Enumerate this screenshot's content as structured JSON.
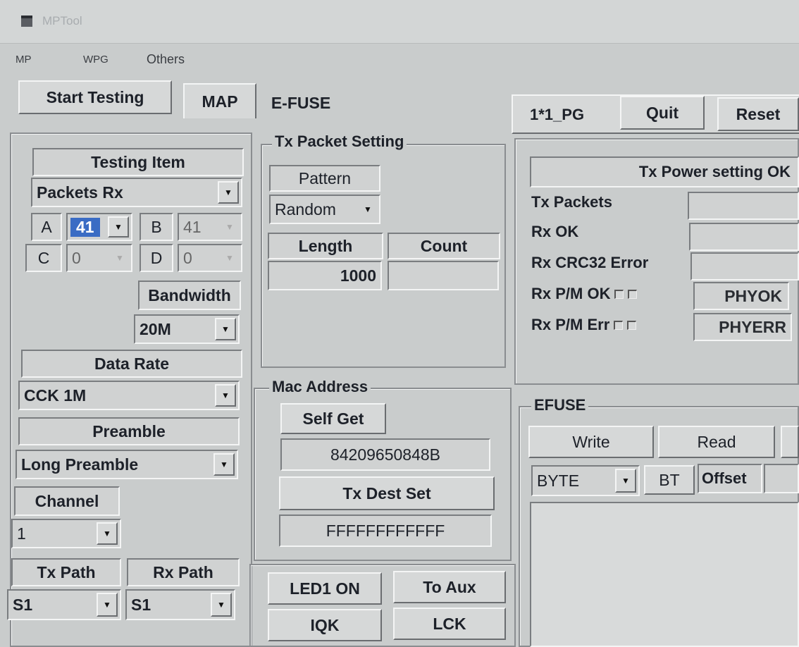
{
  "window": {
    "title": "MPTool"
  },
  "menu": {
    "items": [
      "MP",
      "WPG",
      "Others"
    ]
  },
  "toolbar": {
    "start_testing": "Start Testing",
    "tabs": [
      "MAP",
      "E-FUSE"
    ],
    "right_label": "1*1_PG",
    "quit": "Quit",
    "reset": "Reset"
  },
  "left": {
    "testing_item_label": "Testing Item",
    "testing_item_value": "Packets Rx",
    "antennas": [
      {
        "letter": "A",
        "value": "41"
      },
      {
        "letter": "B",
        "value": "41"
      },
      {
        "letter": "C",
        "value": "0"
      },
      {
        "letter": "D",
        "value": "0"
      }
    ],
    "bandwidth_label": "Bandwidth",
    "bandwidth_value": "20M",
    "data_rate_label": "Data Rate",
    "data_rate_value": "CCK 1M",
    "preamble_label": "Preamble",
    "preamble_value": "Long Preamble",
    "channel_label": "Channel",
    "channel_value": "1",
    "tx_path_label": "Tx Path",
    "tx_path_value": "S1",
    "rx_path_label": "Rx Path",
    "rx_path_value": "S1"
  },
  "tx_packet": {
    "title": "Tx Packet Setting",
    "pattern_label": "Pattern",
    "pattern_value": "Random",
    "length_label": "Length",
    "length_value": "1000",
    "count_label": "Count",
    "count_value": ""
  },
  "mac": {
    "title": "Mac Address",
    "self_get": "Self Get",
    "self_value": "84209650848B",
    "tx_dest_set": "Tx Dest Set",
    "dest_value": "FFFFFFFFFFFF"
  },
  "bottom_buttons": {
    "led": "LED1 ON",
    "to_aux": "To Aux",
    "iqk": "IQK",
    "lck": "LCK"
  },
  "status": {
    "message": "Tx Power setting OK",
    "tx_packets": "Tx Packets",
    "rx_ok": "Rx OK",
    "rx_crc": "Rx CRC32 Error",
    "rx_pm_ok": "Rx P/M OK",
    "rx_pm_err": "Rx P/M Err",
    "phyok": "PHYOK",
    "phyerr": "PHYERR"
  },
  "efuse": {
    "title": "EFUSE",
    "write": "Write",
    "read": "Read",
    "mode_value": "BYTE",
    "bt": "BT",
    "offset_label": "Offset"
  }
}
